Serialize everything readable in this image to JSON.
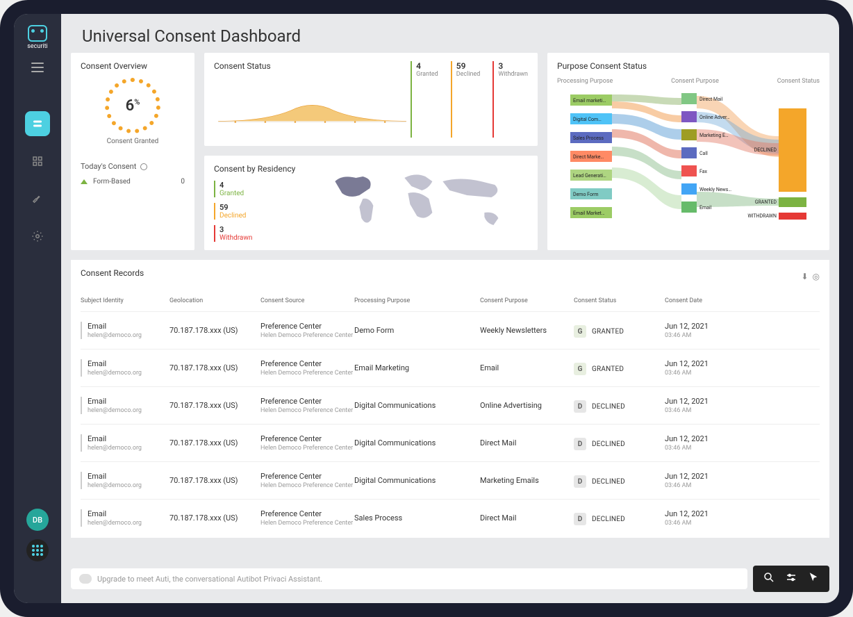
{
  "brand": "securiti",
  "pageTitle": "Universal Consent Dashboard",
  "sidebar": {
    "avatar": "DB"
  },
  "overview": {
    "title": "Consent Overview",
    "gaugeValue": "6",
    "gaugeUnit": "%",
    "gaugeLabel": "Consent Granted",
    "todayLabel": "Today's Consent",
    "formBasedLabel": "Form-Based",
    "formBasedValue": "0"
  },
  "consentStatus": {
    "title": "Consent Status",
    "stats": [
      {
        "num": "4",
        "label": "Granted"
      },
      {
        "num": "59",
        "label": "Declined"
      },
      {
        "num": "3",
        "label": "Withdrawn"
      }
    ]
  },
  "residency": {
    "title": "Consent by Residency",
    "stats": [
      {
        "num": "4",
        "label": "Granted",
        "cls": "green"
      },
      {
        "num": "59",
        "label": "Declined",
        "cls": "orange"
      },
      {
        "num": "3",
        "label": "Withdrawn",
        "cls": "red"
      }
    ]
  },
  "purpose": {
    "title": "Purpose Consent Status",
    "cols": [
      "Processing Purpose",
      "Consent Purpose",
      "Consent Status"
    ],
    "leftNodes": [
      "Email marketi…",
      "Digital Com…",
      "Sales Process",
      "Direct Marke…",
      "Lead Generati…",
      "Demo Form",
      "Email Market…"
    ],
    "midNodes": [
      "Direct Mail",
      "Online Adver…",
      "Marketing E…",
      "Call",
      "Fax",
      "Weekly News…",
      "Email"
    ],
    "rightNodes": [
      "DECLINED",
      "GRANTED",
      "WITHDRAWN"
    ]
  },
  "records": {
    "title": "Consent Records",
    "columns": [
      "Subject Identity",
      "Geolocation",
      "Consent Source",
      "Processing Purpose",
      "Consent Purpose",
      "Consent Status",
      "Consent Date"
    ],
    "rows": [
      {
        "id": "Email",
        "email": "helen@democo.org",
        "geo": "70.187.178.xxx (US)",
        "src": "Preference Center",
        "srcSub": "Helen Democo Preference Center",
        "purpose": "Demo Form",
        "cpurpose": "Weekly Newsletters",
        "status": "GRANTED",
        "sChip": "G",
        "date": "Jun 12, 2021",
        "time": "03:46 AM"
      },
      {
        "id": "Email",
        "email": "helen@democo.org",
        "geo": "70.187.178.xxx (US)",
        "src": "Preference Center",
        "srcSub": "Helen Democo Preference Center",
        "purpose": "Email Marketing",
        "cpurpose": "Email",
        "status": "GRANTED",
        "sChip": "G",
        "date": "Jun 12, 2021",
        "time": "03:46 AM"
      },
      {
        "id": "Email",
        "email": "helen@democo.org",
        "geo": "70.187.178.xxx (US)",
        "src": "Preference Center",
        "srcSub": "Helen Democo Preference Center",
        "purpose": "Digital Communications",
        "cpurpose": "Online Advertising",
        "status": "DECLINED",
        "sChip": "D",
        "date": "Jun 12, 2021",
        "time": "03:46 AM"
      },
      {
        "id": "Email",
        "email": "helen@democo.org",
        "geo": "70.187.178.xxx (US)",
        "src": "Preference Center",
        "srcSub": "Helen Democo Preference Center",
        "purpose": "Digital Communications",
        "cpurpose": "Direct Mail",
        "status": "DECLINED",
        "sChip": "D",
        "date": "Jun 12, 2021",
        "time": "03:46 AM"
      },
      {
        "id": "Email",
        "email": "helen@democo.org",
        "geo": "70.187.178.xxx (US)",
        "src": "Preference Center",
        "srcSub": "Helen Democo Preference Center",
        "purpose": "Digital Communications",
        "cpurpose": "Marketing Emails",
        "status": "DECLINED",
        "sChip": "D",
        "date": "Jun 12, 2021",
        "time": "03:46 AM"
      },
      {
        "id": "Email",
        "email": "helen@democo.org",
        "geo": "70.187.178.xxx (US)",
        "src": "Preference Center",
        "srcSub": "Helen Democo Preference Center",
        "purpose": "Sales Process",
        "cpurpose": "Direct Mail",
        "status": "DECLINED",
        "sChip": "D",
        "date": "Jun 12, 2021",
        "time": "03:46 AM"
      }
    ]
  },
  "chatPlaceholder": "Upgrade to meet Auti, the conversational Autibot Privaci Assistant."
}
